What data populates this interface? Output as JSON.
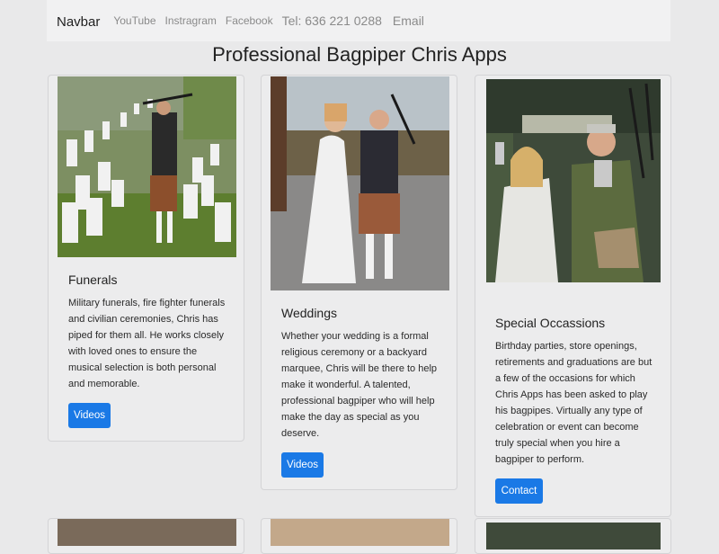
{
  "navbar": {
    "brand": "Navbar",
    "links": [
      "YouTube",
      "Instragram",
      "Facebook"
    ],
    "phone": "Tel: 636 221 0288",
    "email": "Email"
  },
  "page_title": "Professional Bagpiper Chris Apps",
  "cards": [
    {
      "title": "Funerals",
      "text": "Military funerals, fire fighter funerals and civilian ceremonies, Chris has piped for them all. He works closely with loved ones to ensure the musical selection is both personal and memorable.",
      "button": "Videos"
    },
    {
      "title": "Weddings",
      "text": "Whether your wedding is a formal religious ceremony or a backyard marquee, Chris will be there to help make it wonderful. A talented, professional bagpiper who will help make the day as special as you deserve.",
      "button": "Videos"
    },
    {
      "title": "Special Occassions",
      "text": "Birthday parties, store openings, retirements and graduations are but a few of the occasions for which Chris Apps has been asked to play his bagpipes. Virtually any type of celebration or event can become truly special when you hire a bagpiper to perform.",
      "button": "Contact"
    }
  ],
  "colors": {
    "accent": "#1a79e6",
    "page_bg": "#e9e9ea",
    "navbar_bg": "#f1f1f2"
  }
}
